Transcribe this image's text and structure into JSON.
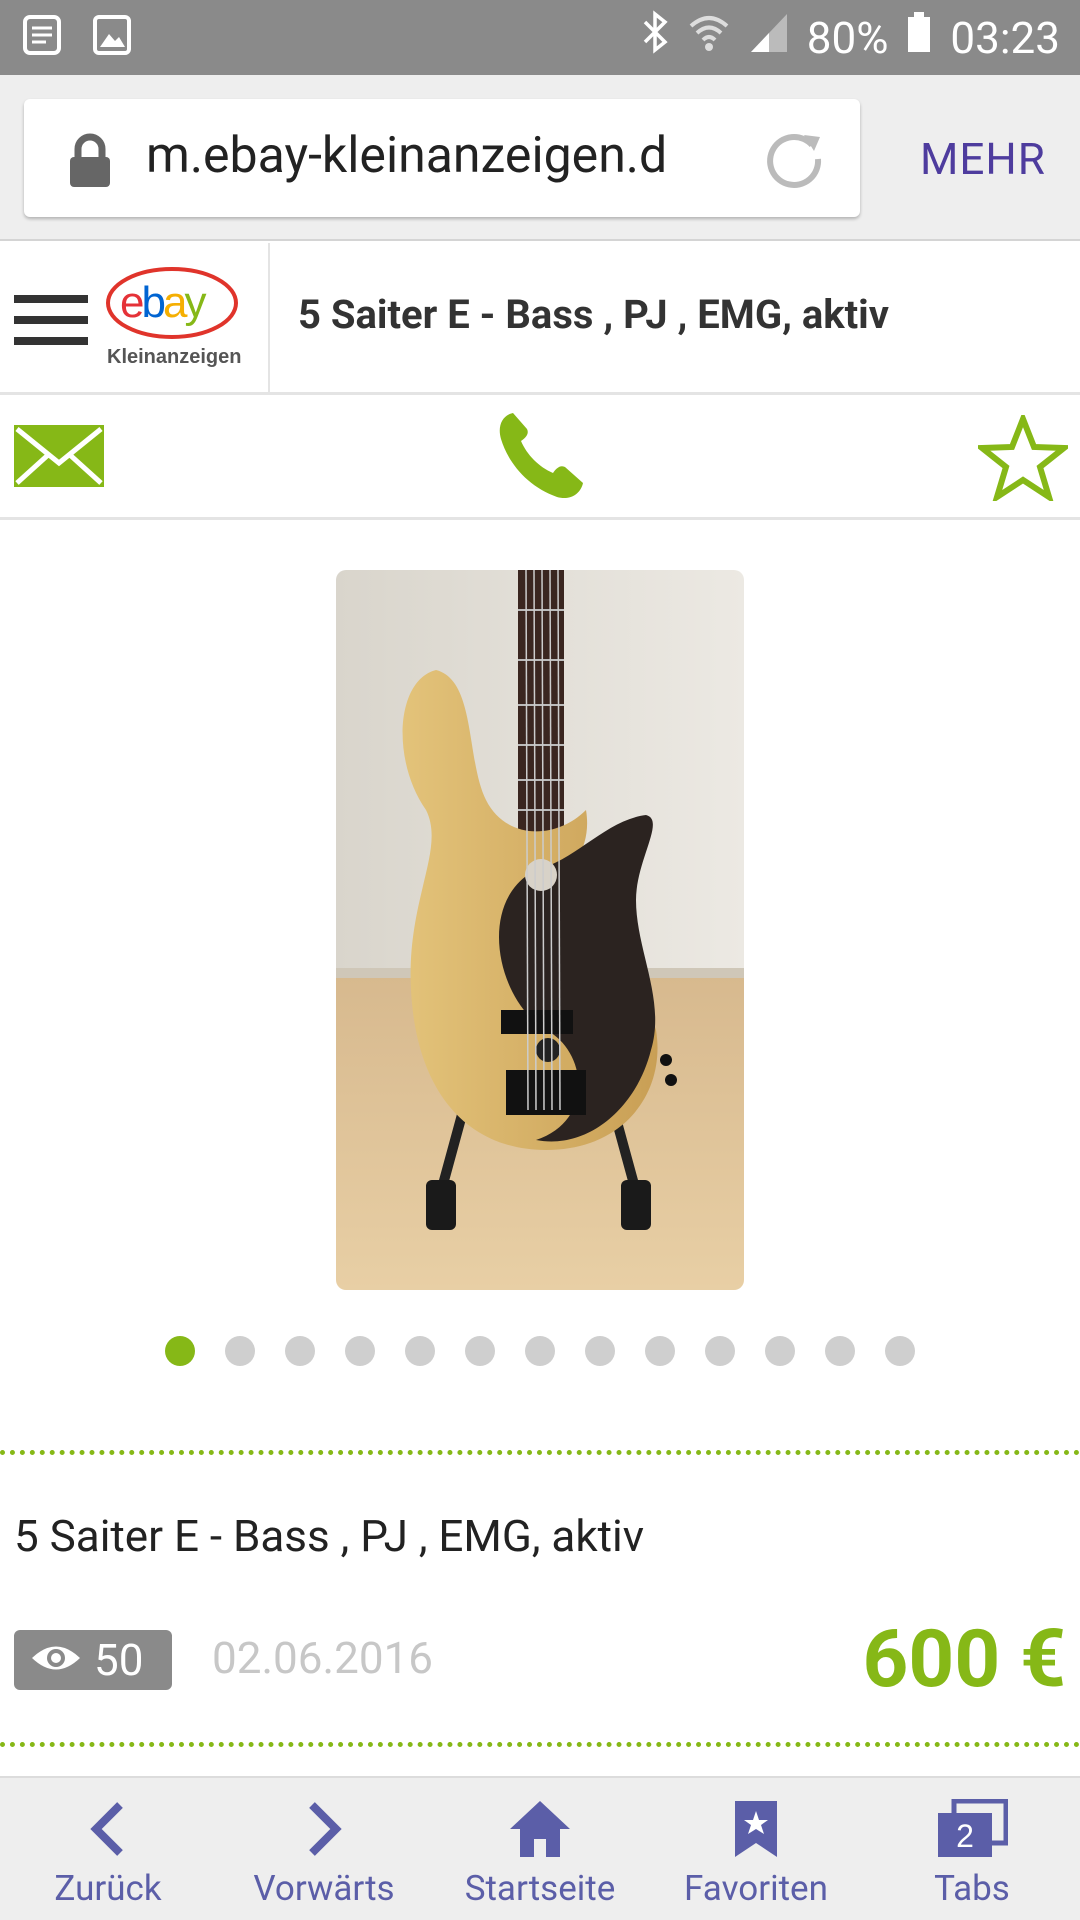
{
  "status_bar": {
    "battery": "80%",
    "time": "03:23"
  },
  "browser": {
    "url": "m.ebay-kleinanzeigen.d",
    "more_label": "MEHR"
  },
  "header": {
    "logo_text": "ebay",
    "logo_sub": "Kleinanzeigen",
    "title": "5 Saiter E - Bass , PJ , EMG, aktiv"
  },
  "actions": {
    "message_icon": "envelope-icon",
    "call_icon": "phone-icon",
    "favorite_icon": "star-outline-icon"
  },
  "gallery": {
    "image_count": 13,
    "active_index": 0
  },
  "listing": {
    "title": "5 Saiter E - Bass , PJ , EMG, aktiv",
    "views": "50",
    "date": "02.06.2016",
    "price": "600 €"
  },
  "bottom_nav": {
    "items": [
      {
        "label": "Zurück",
        "icon": "chevron-left-icon"
      },
      {
        "label": "Vorwärts",
        "icon": "chevron-right-icon"
      },
      {
        "label": "Startseite",
        "icon": "home-icon"
      },
      {
        "label": "Favoriten",
        "icon": "bookmark-star-icon"
      },
      {
        "label": "Tabs",
        "icon": "tabs-icon",
        "badge": "2"
      }
    ]
  },
  "colors": {
    "accent_green": "#86b817",
    "nav_purple": "#5b5ea8",
    "status_gray": "#8a8a8a"
  }
}
